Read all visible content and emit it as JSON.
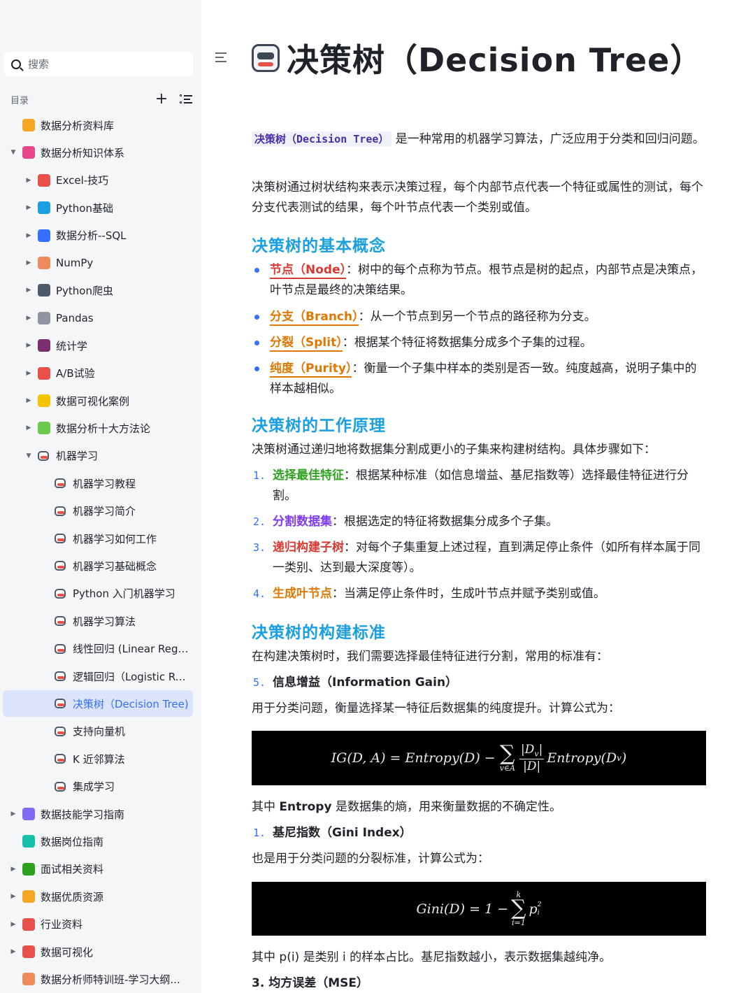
{
  "sidebar": {
    "search_placeholder": "搜索",
    "toc_label": "目录",
    "add_symbol": "+",
    "items": [
      {
        "label": "数据分析资料库",
        "level": 0,
        "arrow": "",
        "color": "#f5a623"
      },
      {
        "label": "数据分析知识体系",
        "level": 0,
        "arrow": "▼",
        "color": "#e8458b"
      },
      {
        "label": "Excel-技巧",
        "level": 1,
        "arrow": "▶",
        "color": "#e8504a"
      },
      {
        "label": "Python基础",
        "level": 1,
        "arrow": "▶",
        "color": "#1a9fe0"
      },
      {
        "label": "数据分析--SQL",
        "level": 1,
        "arrow": "▶",
        "color": "#3370ff"
      },
      {
        "label": "NumPy",
        "level": 1,
        "arrow": "▶",
        "color": "#f08a5d"
      },
      {
        "label": "Python爬虫",
        "level": 1,
        "arrow": "▶",
        "color": "#4e5969"
      },
      {
        "label": "Pandas",
        "level": 1,
        "arrow": "▶",
        "color": "#8f959e"
      },
      {
        "label": "统计学",
        "level": 1,
        "arrow": "▶",
        "color": "#7a2f6e"
      },
      {
        "label": "A/B试验",
        "level": 1,
        "arrow": "▶",
        "color": "#e8504a"
      },
      {
        "label": "数据可视化案例",
        "level": 1,
        "arrow": "▶",
        "color": "#f5c400"
      },
      {
        "label": "数据分析十大方法论",
        "level": 1,
        "arrow": "▶",
        "color": "#6bc950"
      },
      {
        "label": "机器学习",
        "level": 1,
        "arrow": "▼",
        "color": "robot"
      },
      {
        "label": "机器学习教程",
        "level": 2,
        "arrow": "",
        "color": "robot"
      },
      {
        "label": "机器学习简介",
        "level": 2,
        "arrow": "",
        "color": "robot"
      },
      {
        "label": "机器学习如何工作",
        "level": 2,
        "arrow": "",
        "color": "robot"
      },
      {
        "label": "机器学习基础概念",
        "level": 2,
        "arrow": "",
        "color": "robot"
      },
      {
        "label": "Python 入门机器学习",
        "level": 2,
        "arrow": "",
        "color": "robot"
      },
      {
        "label": "机器学习算法",
        "level": 2,
        "arrow": "",
        "color": "robot"
      },
      {
        "label": "线性回归 (Linear Regre...",
        "level": 2,
        "arrow": "",
        "color": "robot"
      },
      {
        "label": "逻辑回归（Logistic Reg...",
        "level": 2,
        "arrow": "",
        "color": "robot"
      },
      {
        "label": "决策树（Decision Tree)",
        "level": 2,
        "arrow": "",
        "color": "robot",
        "selected": true
      },
      {
        "label": "支持向量机",
        "level": 2,
        "arrow": "",
        "color": "robot"
      },
      {
        "label": "K 近邻算法",
        "level": 2,
        "arrow": "",
        "color": "robot"
      },
      {
        "label": "集成学习",
        "level": 2,
        "arrow": "",
        "color": "robot"
      },
      {
        "label": "数据技能学习指南",
        "level": 0,
        "arrow": "▶",
        "color": "#7f6bf5"
      },
      {
        "label": "数据岗位指南",
        "level": 0,
        "arrow": "",
        "color": "#14c0a8"
      },
      {
        "label": "面试相关资料",
        "level": 0,
        "arrow": "▶",
        "color": "#2ea121"
      },
      {
        "label": "数据优质资源",
        "level": 0,
        "arrow": "▶",
        "color": "#f5a623"
      },
      {
        "label": "行业资料",
        "level": 0,
        "arrow": "▶",
        "color": "#e8504a"
      },
      {
        "label": "数据可视化",
        "level": 0,
        "arrow": "▶",
        "color": "#e8504a"
      },
      {
        "label": "数据分析师特训班-学习大纲...",
        "level": 0,
        "arrow": "",
        "color": "#f08a5d"
      }
    ]
  },
  "page": {
    "title": "决策树（Decision Tree）",
    "intro_term": "决策树（Decision Tree）",
    "intro_rest": " 是一种常用的机器学习算法，广泛应用于分类和回归问题。",
    "p2": "决策树通过树状结构来表示决策过程，每个内部节点代表一个特征或属性的测试，每个分支代表测试的结果，每个叶节点代表一个类别或值。",
    "h_basic": "决策树的基本概念",
    "basic": [
      {
        "term": "节点（Node）",
        "desc": "：树中的每个点称为节点。根节点是树的起点，内部节点是决策点，叶节点是最终的决策结果。",
        "cls": "t-red"
      },
      {
        "term": "分支（Branch）",
        "desc": "：从一个节点到另一个节点的路径称为分支。",
        "cls": "t-orange"
      },
      {
        "term": "分裂（Split）",
        "desc": "：根据某个特征将数据集分成多个子集的过程。",
        "cls": "t-orange"
      },
      {
        "term": "纯度（Purity）",
        "desc": "：衡量一个子集中样本的类别是否一致。纯度越高，说明子集中的样本越相似。",
        "cls": "t-orange"
      }
    ],
    "h_work": "决策树的工作原理",
    "work_intro": "决策树通过递归地将数据集分割成更小的子集来构建树结构。具体步骤如下：",
    "steps": [
      {
        "num": "1.",
        "key": "选择最佳特征",
        "desc": "：根据某种标准（如信息增益、基尼指数等）选择最佳特征进行分割。",
        "cls": "k-green"
      },
      {
        "num": "2.",
        "key": "分割数据集",
        "desc": "：根据选定的特征将数据集分成多个子集。",
        "cls": "k-purple"
      },
      {
        "num": "3.",
        "key": "递归构建子树",
        "desc": "：对每个子集重复上述过程，直到满足停止条件（如所有样本属于同一类别、达到最大深度等）。",
        "cls": "k-red"
      },
      {
        "num": "4.",
        "key": "生成叶节点",
        "desc": "：当满足停止条件时，生成叶节点并赋予类别或值。",
        "cls": "k-orange"
      }
    ],
    "h_std": "决策树的构建标准",
    "std_intro": "在构建决策树时，我们需要选择最佳特征进行分割，常用的标准有：",
    "ig_num": "5.",
    "ig_title": "信息增益（Information Gain）",
    "ig_desc": "用于分类问题，衡量选择某一特征后数据集的纯度提升。计算公式为：",
    "ig_formula_left": "IG(D, A) = Entropy(D) −",
    "ig_sum_top": "",
    "ig_sum_bottom": "v∈A",
    "ig_frac_num": "|D",
    "ig_frac_num_sub": "v",
    "ig_frac_den": "|D|",
    "ig_formula_right": "Entropy(D",
    "ig_formula_right_sub": "v",
    "entropy_pre": "其中 ",
    "entropy_word": "Entropy",
    "entropy_post": " 是数据集的熵，用来衡量数据的不确定性。",
    "gini_num": "1.",
    "gini_title": "基尼指数（Gini Index）",
    "gini_desc": "也是用于分类问题的分裂标准，计算公式为：",
    "gini_left": "Gini(D) = 1 −",
    "gini_sum_top": "k",
    "gini_sum_bottom": "i=1",
    "gini_term": "p",
    "gini_term_sub": "i",
    "gini_term_sup": "2",
    "gini_note": "其中 p(i) 是类别 i 的样本占比。基尼指数越小，表示数据集越纯净。",
    "mse_title": "3. 均方误差（MSE）"
  }
}
